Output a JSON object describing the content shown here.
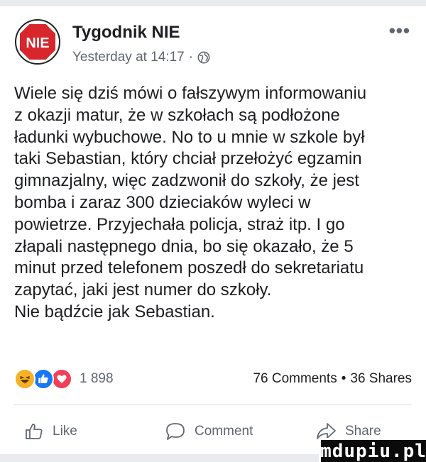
{
  "post": {
    "author": "Tygodnik NIE",
    "avatar_text": "NIE",
    "timestamp": "Yesterday at 14:17",
    "separator": "·",
    "more_label": "•••",
    "body_lines": [
      "Wiele się dziś mówi o fałszywym informowaniu",
      "z okazji matur, że w szkołach są podłożone",
      "ładunki wybuchowe. No to u mnie w szkole był",
      "taki Sebastian, który chciał przełożyć egzamin",
      "gimnazjalny, więc zadzwonił do szkoły, że jest",
      "bomba i zaraz 300 dzieciaków wyleci w",
      "powietrze. Przyjechała policja, straż itp. I go",
      "złapali następnego dnia, bo się okazało, że 5",
      "minut przed telefonem poszedł do sekretariatu",
      "zapytać, jaki jest numer do szkoły.",
      "Nie bądźcie jak Sebastian."
    ]
  },
  "stats": {
    "reaction_count": "1 898",
    "comments": "76 Comments",
    "dot": "•",
    "shares": "36 Shares"
  },
  "actions": {
    "like": "Like",
    "comment": "Comment",
    "share": "Share"
  },
  "watermark": "mdupiu.pl",
  "colors": {
    "brand_red": "#d8262d",
    "like_blue": "#1877f2",
    "love_red": "#f33e58",
    "haha_yellow": "#f7b125",
    "secondary_text": "#606770"
  },
  "icons": [
    "avatar-logo",
    "globe-icon",
    "more-options-icon",
    "haha-reaction-icon",
    "like-reaction-icon",
    "love-reaction-icon",
    "like-thumb-icon",
    "comment-bubble-icon",
    "share-arrow-icon"
  ]
}
